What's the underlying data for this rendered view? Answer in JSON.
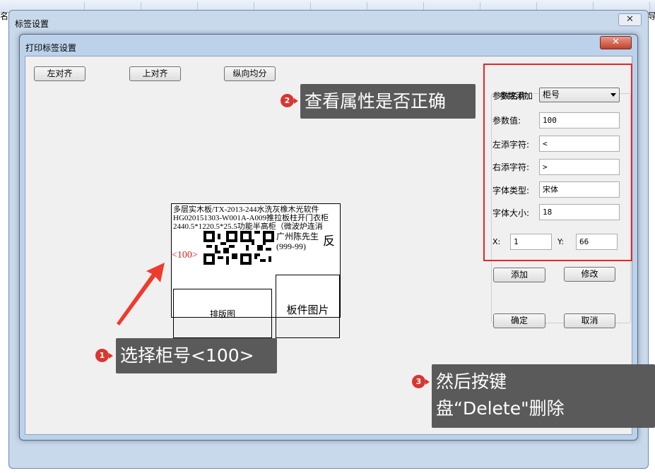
{
  "background_app": {
    "left_text": "名称",
    "right_text": "导"
  },
  "outer_window": {
    "title": "标签设置",
    "close_glyph": "✕"
  },
  "inner_window": {
    "title": "打印标签设置",
    "close_glyph": "✕"
  },
  "toolbar": {
    "align_left": "左对齐",
    "align_top": "上对齐",
    "distribute_vertical": "纵向均分"
  },
  "label_preview": {
    "line1": "多层实木板/TX-2013-244水洗灰橡木光软件",
    "line2": "HG020151303-W001A-A009推拉板柱开门衣柜",
    "line3": "2440.5*1220.5*25.5功能半高柜（微波炉连消",
    "customer_name": "广州陈先生",
    "customer_code": "(999-99)",
    "reverse_mark": "反",
    "cabinet_number": "<100>",
    "layout_box": "排版图",
    "panel_image_box": "板件图片"
  },
  "params": {
    "group_title": "参数添加",
    "name_label": "参数名称:",
    "name_value": "柜号",
    "value_label": "参数值:",
    "value_value": "100",
    "left_char_label": "左添字符:",
    "left_char_value": "<",
    "right_char_label": "右添字符:",
    "right_char_value": ">",
    "font_type_label": "字体类型:",
    "font_type_value": "宋体",
    "font_size_label": "字体大小:",
    "font_size_value": "18",
    "x_label": "X:",
    "x_value": "1",
    "y_label": "Y:",
    "y_value": "66",
    "add_button": "添加",
    "modify_button": "修改"
  },
  "dialog_buttons": {
    "ok": "确定",
    "cancel": "取消"
  },
  "callouts": {
    "step1_badge": "1",
    "step1_text": "选择柜号<100>",
    "step2_badge": "2",
    "step2_text": "查看属性是否正确",
    "step3_badge": "3",
    "step3_line1": "然后按键",
    "step3_line2": "盘“Delete\"删除"
  },
  "colors": {
    "highlight_red": "#e3262b",
    "callout_bg": "#5a5a5a",
    "badge_red": "#d93631",
    "cabinet_number_red": "#d9241a"
  }
}
